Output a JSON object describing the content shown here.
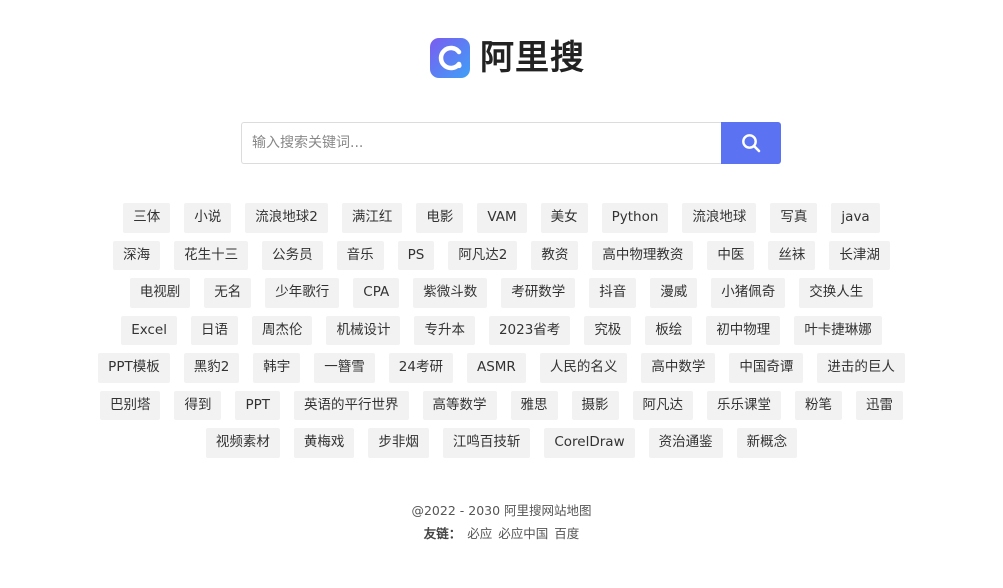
{
  "brand": {
    "name": "阿里搜",
    "logo_gradient": [
      "#7a5cf0",
      "#3fa0f7"
    ]
  },
  "search": {
    "placeholder": "输入搜索关键词...",
    "button_color": "#5b73f3"
  },
  "tags": [
    "三体",
    "小说",
    "流浪地球2",
    "满江红",
    "电影",
    "VAM",
    "美女",
    "Python",
    "流浪地球",
    "写真",
    "java",
    "深海",
    "花生十三",
    "公务员",
    "音乐",
    "PS",
    "阿凡达2",
    "教资",
    "高中物理教资",
    "中医",
    "丝袜",
    "长津湖",
    "电视剧",
    "无名",
    "少年歌行",
    "CPA",
    "紫微斗数",
    "考研数学",
    "抖音",
    "漫威",
    "小猪佩奇",
    "交换人生",
    "Excel",
    "日语",
    "周杰伦",
    "机械设计",
    "专升本",
    "2023省考",
    "究极",
    "板绘",
    "初中物理",
    "叶卡捷琳娜",
    "PPT模板",
    "黑豹2",
    "韩宇",
    "一簪雪",
    "24考研",
    "ASMR",
    "人民的名义",
    "高中数学",
    "中国奇谭",
    "进击的巨人",
    "巴别塔",
    "得到",
    "PPT",
    "英语的平行世界",
    "高等数学",
    "雅思",
    "摄影",
    "阿凡达",
    "乐乐课堂",
    "粉笔",
    "迅雷",
    "视频素材",
    "黄梅戏",
    "步非烟",
    "江鸣百技斩",
    "CorelDraw",
    "资治通鉴",
    "新概念"
  ],
  "footer": {
    "copyright": "@2022 - 2030 阿里搜网站地图",
    "links_label": "友链：",
    "links": [
      "必应",
      "必应中国",
      "百度"
    ]
  }
}
